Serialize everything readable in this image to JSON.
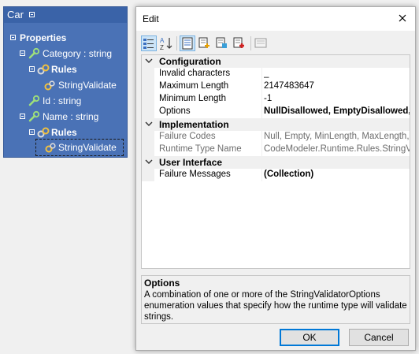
{
  "tree": {
    "title": "Car",
    "properties_label": "Properties",
    "items": [
      {
        "label": "Category : string"
      },
      {
        "label": "Rules"
      },
      {
        "label": "StringValidate"
      },
      {
        "label": "Id : string"
      },
      {
        "label": "Name : string"
      },
      {
        "label": "Rules"
      },
      {
        "label": "StringValidate"
      }
    ]
  },
  "dialog": {
    "title": "Edit",
    "close_glyph": "✕",
    "toolbar": {
      "buttons": [
        "categorized-icon",
        "alphabetical-icon",
        "properties-icon",
        "add-icon",
        "edit-icon",
        "remove-icon",
        "property-pages-icon"
      ]
    },
    "grid": {
      "categories": [
        {
          "name": "Configuration",
          "rows": [
            {
              "name": "Invalid characters",
              "value": "_",
              "readonly": false,
              "bold": false
            },
            {
              "name": "Maximum Length",
              "value": "2147483647",
              "readonly": false,
              "bold": false
            },
            {
              "name": "Minimum Length",
              "value": "-1",
              "readonly": false,
              "bold": false
            },
            {
              "name": "Options",
              "value": "NullDisallowed, EmptyDisallowed,",
              "readonly": false,
              "bold": true
            }
          ]
        },
        {
          "name": "Implementation",
          "rows": [
            {
              "name": "Failure Codes",
              "value": "Null, Empty, MinLength, MaxLength, Inva",
              "readonly": true,
              "bold": false
            },
            {
              "name": "Runtime Type Name",
              "value": "CodeModeler.Runtime.Rules.StringValidat",
              "readonly": true,
              "bold": false
            }
          ]
        },
        {
          "name": "User Interface",
          "rows": [
            {
              "name": "Failure Messages",
              "value": "(Collection)",
              "readonly": false,
              "bold": true
            }
          ]
        }
      ]
    },
    "description": {
      "title": "Options",
      "text": "A combination of one or more of the StringValidatorOptions enumeration values that specify how the runtime type will validate strings."
    },
    "ok_label": "OK",
    "cancel_label": "Cancel"
  },
  "colors": {
    "tree_bg": "#4a72b6",
    "tree_header": "#3a63a8",
    "accent": "#0078d7",
    "selected_tool": "#cce4f7"
  }
}
